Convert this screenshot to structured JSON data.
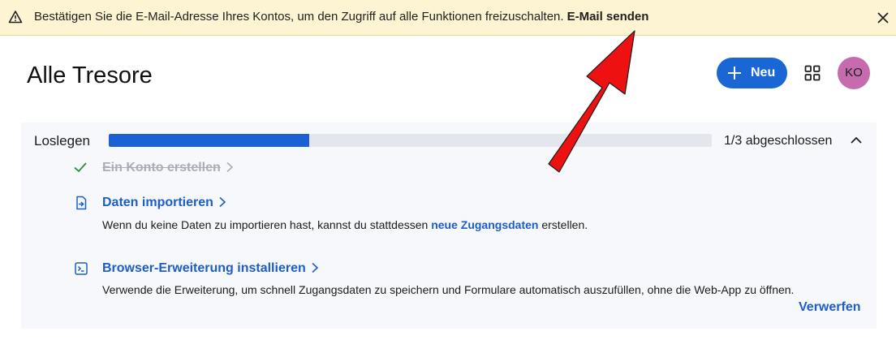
{
  "banner": {
    "message": "Bestätigen Sie die E-Mail-Adresse Ihres Kontos, um den Zugriff auf alle Funktionen freizuschalten.",
    "action_label": "E-Mail senden",
    "icon": "warning-icon",
    "close_icon": "close-icon"
  },
  "header": {
    "title": "Alle Tresore",
    "new_button_label": "Neu",
    "grid_icon": "grid-icon",
    "avatar_initials": "KO"
  },
  "onboarding": {
    "title": "Loslegen",
    "progress": 0.333,
    "progress_label": "1/3 abgeschlossen",
    "steps": [
      {
        "title": "Ein Konto erstellen",
        "completed": true,
        "icon": "check-icon"
      },
      {
        "title": "Daten importieren",
        "completed": false,
        "icon": "import-icon",
        "description_before": "Wenn du keine Daten zu importieren hast, kannst du stattdessen",
        "description_link": "neue Zugangsdaten",
        "description_after": "erstellen."
      },
      {
        "title": "Browser-Erweiterung installieren",
        "completed": false,
        "icon": "extension-icon",
        "description": "Verwende die Erweiterung, um schnell Zugangsdaten zu speichern und Formulare automatisch auszufüllen, ohne die Web-App zu öffnen."
      }
    ],
    "dismiss_label": "Verwerfen"
  },
  "colors": {
    "banner_background": "#fdf4d3",
    "brand_blue": "#1a66d4",
    "avatar": "#c66bad",
    "annotation_arrow": "#ee1111"
  }
}
